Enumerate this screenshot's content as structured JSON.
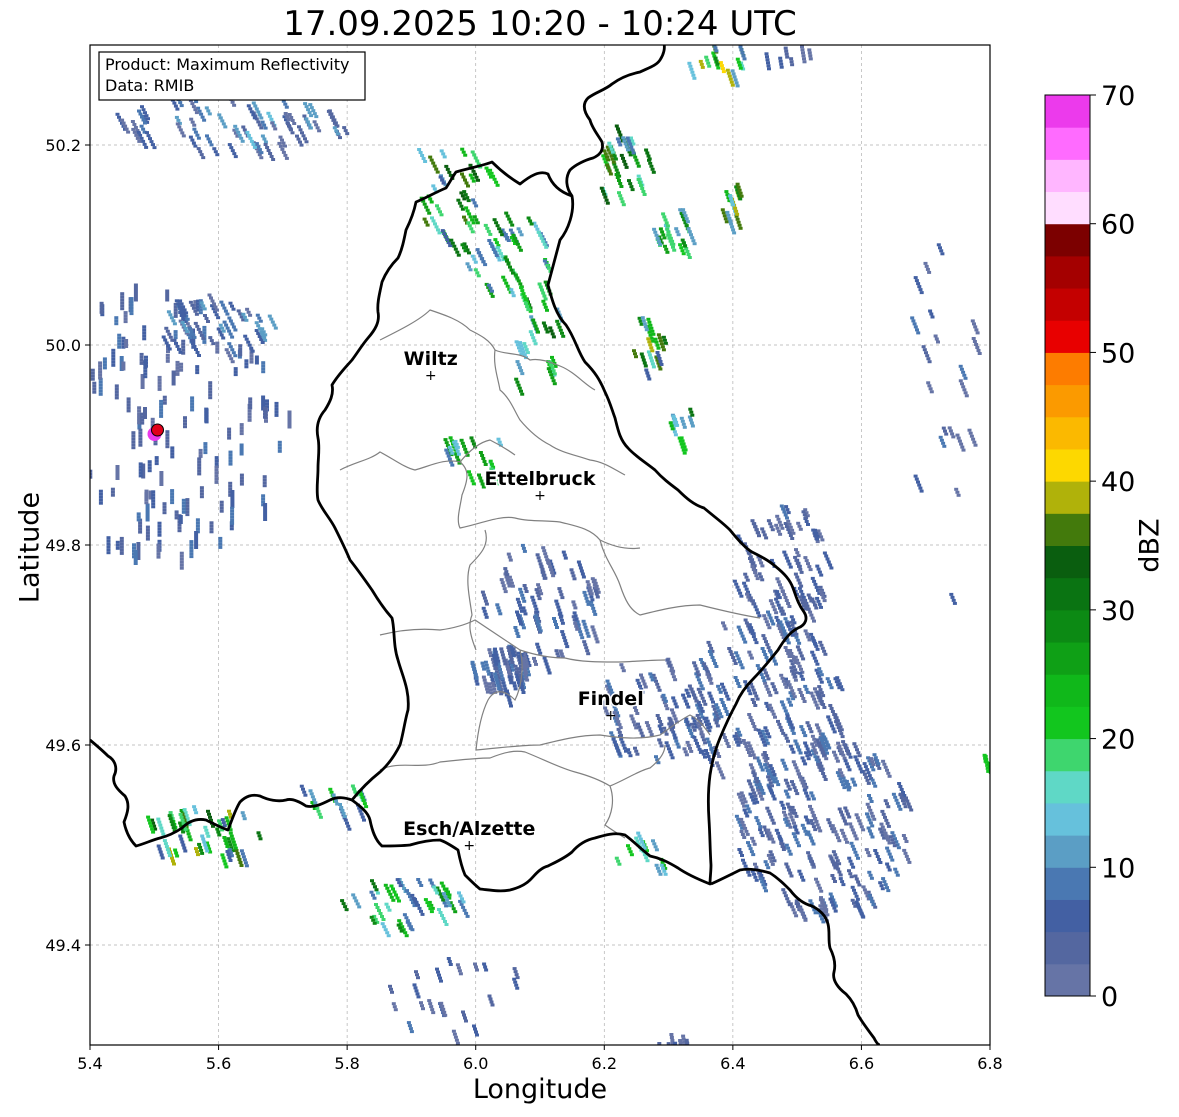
{
  "title": "17.09.2025 10:20 - 10:24 UTC",
  "product_box": {
    "line1": "Product: Maximum Reflectivity",
    "line2": "Data: RMIB"
  },
  "axes": {
    "xlabel": "Longitude",
    "ylabel": "Latitude",
    "x_ticks": [
      "5.4",
      "5.6",
      "5.8",
      "6.0",
      "6.2",
      "6.4",
      "6.6",
      "6.8"
    ],
    "y_ticks": [
      "49.4",
      "49.6",
      "49.8",
      "50.0",
      "50.2"
    ],
    "x_range": [
      5.4,
      6.8
    ],
    "y_range": [
      49.3,
      50.3
    ],
    "grid": true
  },
  "colorbar": {
    "label": "dBZ",
    "ticks": [
      "0",
      "10",
      "20",
      "30",
      "40",
      "50",
      "60",
      "70"
    ],
    "range": [
      0,
      70
    ],
    "step": 2.5,
    "colors": [
      "#6674a6",
      "#5467a0",
      "#4360a3",
      "#4a78b2",
      "#5b9ec5",
      "#66c1dc",
      "#5fd8c6",
      "#3ed66e",
      "#12c61e",
      "#10b81a",
      "#0fa016",
      "#0c8a14",
      "#0a7412",
      "#0a5e0f",
      "#437a0c",
      "#b0b20a",
      "#fdd800",
      "#fbb900",
      "#fb9a00",
      "#fd7c00",
      "#e80000",
      "#c40000",
      "#a40000",
      "#7c0000",
      "#ffddff",
      "#ffb6ff",
      "#ff6bff",
      "#ec3aec"
    ]
  },
  "places": [
    {
      "name": "Wiltz",
      "lon": 5.93,
      "lat": 49.97
    },
    {
      "name": "Ettelbruck",
      "lon": 6.1,
      "lat": 49.85
    },
    {
      "name": "Findel",
      "lon": 6.21,
      "lat": 49.63
    },
    {
      "name": "Esch/Alzette",
      "lon": 5.99,
      "lat": 49.5
    }
  ],
  "radar_site": {
    "lon": 5.505,
    "lat": 49.915,
    "color": "#e0001a"
  }
}
